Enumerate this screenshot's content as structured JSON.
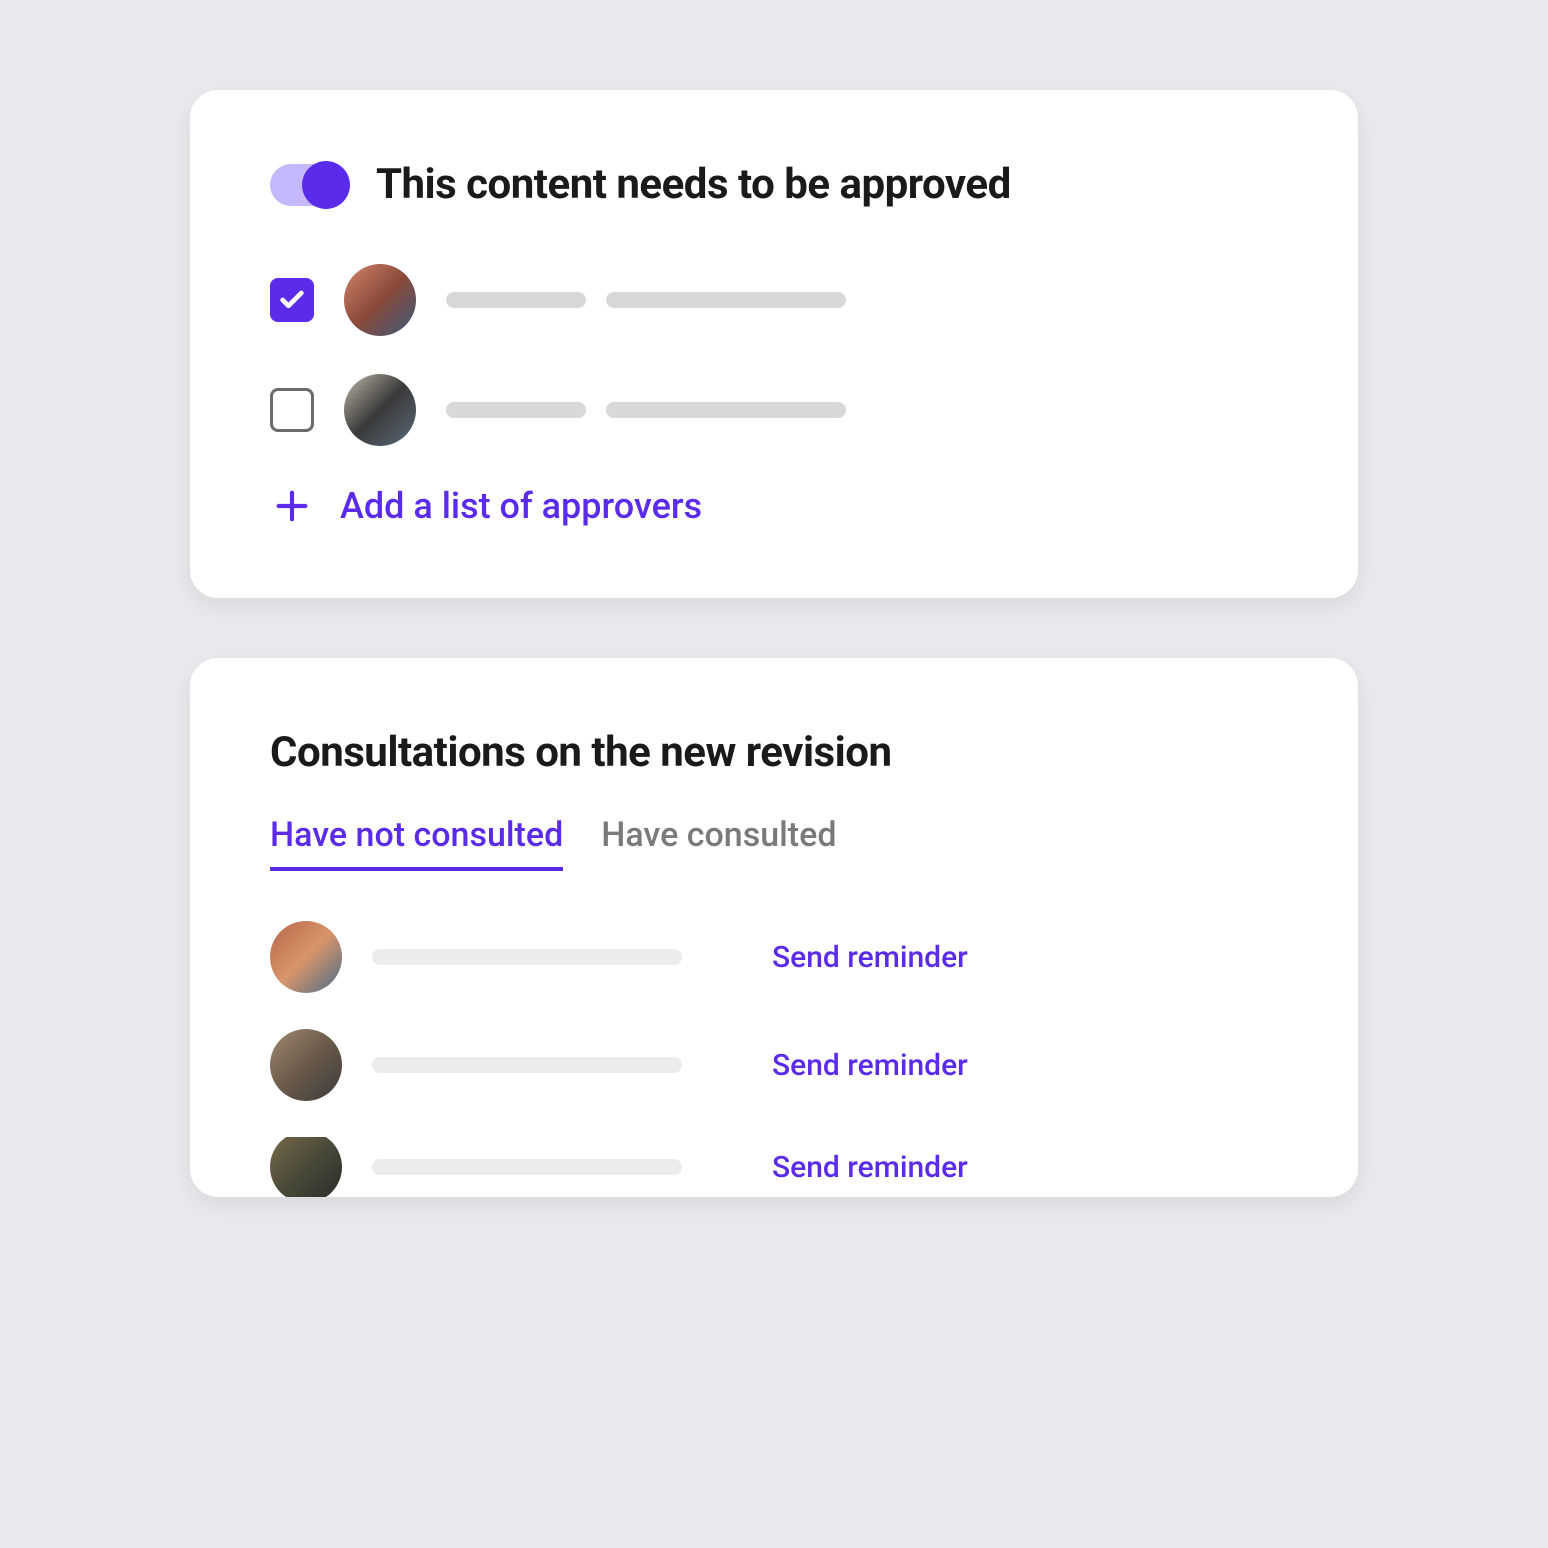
{
  "approval": {
    "toggle_on": true,
    "title": "This content needs to be approved",
    "approvers": [
      {
        "checked": true,
        "avatar": "avatar-1"
      },
      {
        "checked": false,
        "avatar": "avatar-2"
      }
    ],
    "add_label": "Add a list of approvers"
  },
  "consultations": {
    "title": "Consultations on the new revision",
    "tabs": [
      {
        "label": "Have not consulted",
        "active": true
      },
      {
        "label": "Have consulted",
        "active": false
      }
    ],
    "people": [
      {
        "avatar": "avatar-3",
        "action": "Send reminder"
      },
      {
        "avatar": "avatar-4",
        "action": "Send reminder"
      },
      {
        "avatar": "avatar-5",
        "action": "Send reminder"
      }
    ]
  },
  "colors": {
    "accent": "#5b2bea",
    "accent_light": "#c5b8ff"
  }
}
